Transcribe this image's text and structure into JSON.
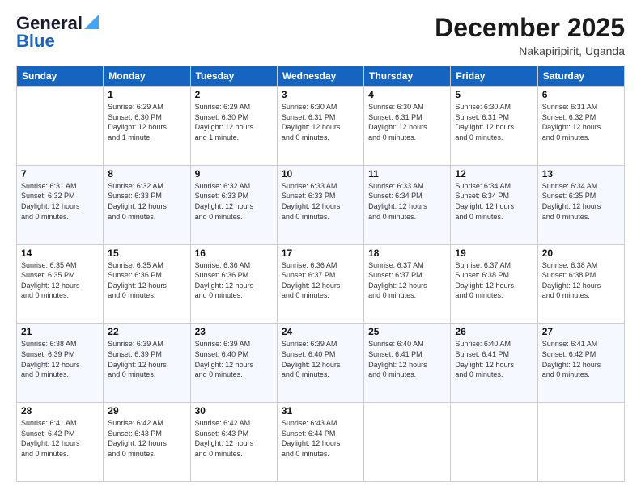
{
  "logo": {
    "part1": "General",
    "part2": "Blue"
  },
  "title": "December 2025",
  "location": "Nakapiripirit, Uganda",
  "days": [
    "Sunday",
    "Monday",
    "Tuesday",
    "Wednesday",
    "Thursday",
    "Friday",
    "Saturday"
  ],
  "weeks": [
    [
      {
        "num": "",
        "content": ""
      },
      {
        "num": "1",
        "content": "Sunrise: 6:29 AM\nSunset: 6:30 PM\nDaylight: 12 hours\nand 1 minute."
      },
      {
        "num": "2",
        "content": "Sunrise: 6:29 AM\nSunset: 6:30 PM\nDaylight: 12 hours\nand 1 minute."
      },
      {
        "num": "3",
        "content": "Sunrise: 6:30 AM\nSunset: 6:31 PM\nDaylight: 12 hours\nand 0 minutes."
      },
      {
        "num": "4",
        "content": "Sunrise: 6:30 AM\nSunset: 6:31 PM\nDaylight: 12 hours\nand 0 minutes."
      },
      {
        "num": "5",
        "content": "Sunrise: 6:30 AM\nSunset: 6:31 PM\nDaylight: 12 hours\nand 0 minutes."
      },
      {
        "num": "6",
        "content": "Sunrise: 6:31 AM\nSunset: 6:32 PM\nDaylight: 12 hours\nand 0 minutes."
      }
    ],
    [
      {
        "num": "7",
        "content": "Sunrise: 6:31 AM\nSunset: 6:32 PM\nDaylight: 12 hours\nand 0 minutes."
      },
      {
        "num": "8",
        "content": "Sunrise: 6:32 AM\nSunset: 6:33 PM\nDaylight: 12 hours\nand 0 minutes."
      },
      {
        "num": "9",
        "content": "Sunrise: 6:32 AM\nSunset: 6:33 PM\nDaylight: 12 hours\nand 0 minutes."
      },
      {
        "num": "10",
        "content": "Sunrise: 6:33 AM\nSunset: 6:33 PM\nDaylight: 12 hours\nand 0 minutes."
      },
      {
        "num": "11",
        "content": "Sunrise: 6:33 AM\nSunset: 6:34 PM\nDaylight: 12 hours\nand 0 minutes."
      },
      {
        "num": "12",
        "content": "Sunrise: 6:34 AM\nSunset: 6:34 PM\nDaylight: 12 hours\nand 0 minutes."
      },
      {
        "num": "13",
        "content": "Sunrise: 6:34 AM\nSunset: 6:35 PM\nDaylight: 12 hours\nand 0 minutes."
      }
    ],
    [
      {
        "num": "14",
        "content": "Sunrise: 6:35 AM\nSunset: 6:35 PM\nDaylight: 12 hours\nand 0 minutes."
      },
      {
        "num": "15",
        "content": "Sunrise: 6:35 AM\nSunset: 6:36 PM\nDaylight: 12 hours\nand 0 minutes."
      },
      {
        "num": "16",
        "content": "Sunrise: 6:36 AM\nSunset: 6:36 PM\nDaylight: 12 hours\nand 0 minutes."
      },
      {
        "num": "17",
        "content": "Sunrise: 6:36 AM\nSunset: 6:37 PM\nDaylight: 12 hours\nand 0 minutes."
      },
      {
        "num": "18",
        "content": "Sunrise: 6:37 AM\nSunset: 6:37 PM\nDaylight: 12 hours\nand 0 minutes."
      },
      {
        "num": "19",
        "content": "Sunrise: 6:37 AM\nSunset: 6:38 PM\nDaylight: 12 hours\nand 0 minutes."
      },
      {
        "num": "20",
        "content": "Sunrise: 6:38 AM\nSunset: 6:38 PM\nDaylight: 12 hours\nand 0 minutes."
      }
    ],
    [
      {
        "num": "21",
        "content": "Sunrise: 6:38 AM\nSunset: 6:39 PM\nDaylight: 12 hours\nand 0 minutes."
      },
      {
        "num": "22",
        "content": "Sunrise: 6:39 AM\nSunset: 6:39 PM\nDaylight: 12 hours\nand 0 minutes."
      },
      {
        "num": "23",
        "content": "Sunrise: 6:39 AM\nSunset: 6:40 PM\nDaylight: 12 hours\nand 0 minutes."
      },
      {
        "num": "24",
        "content": "Sunrise: 6:39 AM\nSunset: 6:40 PM\nDaylight: 12 hours\nand 0 minutes."
      },
      {
        "num": "25",
        "content": "Sunrise: 6:40 AM\nSunset: 6:41 PM\nDaylight: 12 hours\nand 0 minutes."
      },
      {
        "num": "26",
        "content": "Sunrise: 6:40 AM\nSunset: 6:41 PM\nDaylight: 12 hours\nand 0 minutes."
      },
      {
        "num": "27",
        "content": "Sunrise: 6:41 AM\nSunset: 6:42 PM\nDaylight: 12 hours\nand 0 minutes."
      }
    ],
    [
      {
        "num": "28",
        "content": "Sunrise: 6:41 AM\nSunset: 6:42 PM\nDaylight: 12 hours\nand 0 minutes."
      },
      {
        "num": "29",
        "content": "Sunrise: 6:42 AM\nSunset: 6:43 PM\nDaylight: 12 hours\nand 0 minutes."
      },
      {
        "num": "30",
        "content": "Sunrise: 6:42 AM\nSunset: 6:43 PM\nDaylight: 12 hours\nand 0 minutes."
      },
      {
        "num": "31",
        "content": "Sunrise: 6:43 AM\nSunset: 6:44 PM\nDaylight: 12 hours\nand 0 minutes."
      },
      {
        "num": "",
        "content": ""
      },
      {
        "num": "",
        "content": ""
      },
      {
        "num": "",
        "content": ""
      }
    ]
  ]
}
